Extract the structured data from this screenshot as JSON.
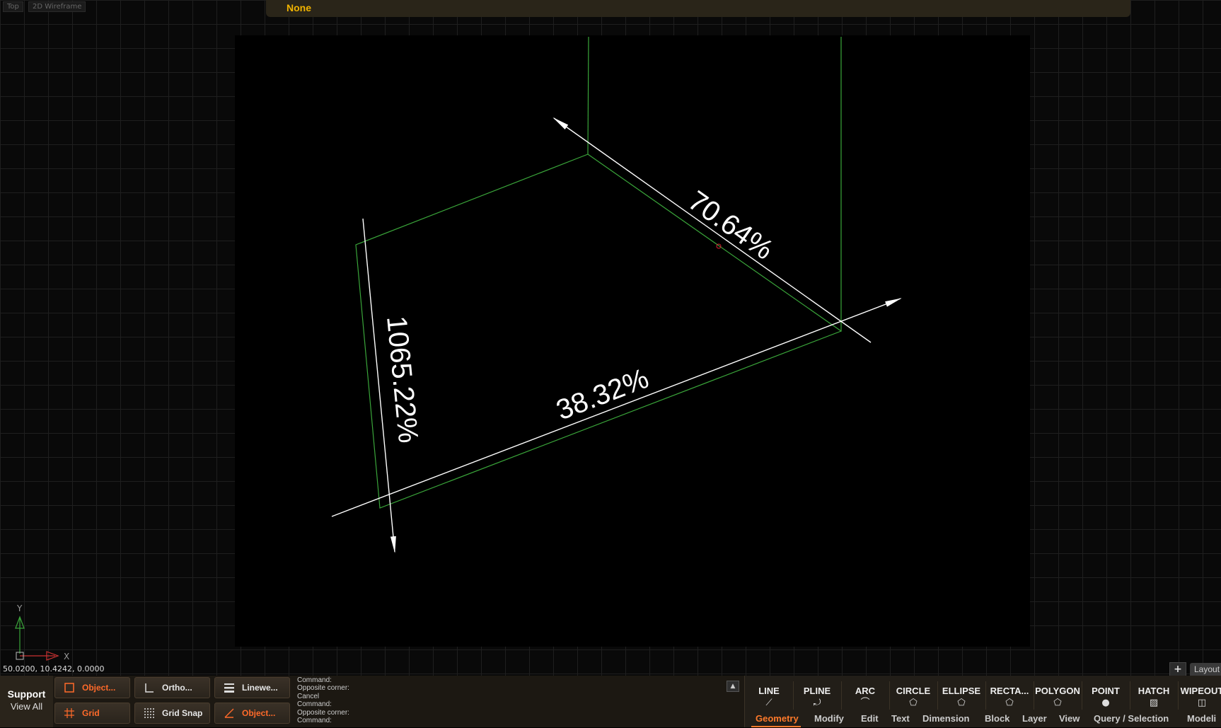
{
  "viewport": {
    "view_label": "Top",
    "visual_style_label": "2D Wireframe",
    "axis_y_label": "Y",
    "axis_x_label": "X"
  },
  "top_bar": {
    "current_value": "None"
  },
  "dimensions": [
    {
      "text": "70.64%"
    },
    {
      "text": "1065.22%"
    },
    {
      "text": "38.32%"
    }
  ],
  "coordinates": "50.0200, 10.4242, 0.0000",
  "layout": {
    "add_label": "+",
    "tab_label": "Layout"
  },
  "support": {
    "title": "Support",
    "view_all": "View All"
  },
  "toggles": [
    {
      "label": "Object...",
      "state": "on",
      "icon": "object-snap-icon"
    },
    {
      "label": "Ortho...",
      "state": "off",
      "icon": "ortho-icon"
    },
    {
      "label": "Linewe...",
      "state": "off",
      "icon": "lineweight-icon"
    },
    {
      "label": "Grid",
      "state": "on",
      "icon": "grid-icon"
    },
    {
      "label": "Grid Snap",
      "state": "off",
      "icon": "grid-snap-icon"
    },
    {
      "label": "Object...",
      "state": "on",
      "icon": "object-tracking-icon"
    }
  ],
  "command_history": [
    "Command:",
    "Opposite corner:",
    "Cancel",
    "Command:",
    "Opposite corner:",
    "Command:"
  ],
  "command_toggle": "▲",
  "ribbon": {
    "tools": [
      {
        "label": "LINE",
        "icon": "line-icon",
        "glyph": "⟋"
      },
      {
        "label": "PLINE",
        "icon": "polyline-icon",
        "glyph": "⤾"
      },
      {
        "label": "ARC",
        "icon": "arc-icon",
        "glyph": "⌒"
      },
      {
        "label": "CIRCLE",
        "icon": "circle-icon",
        "glyph": "⬠"
      },
      {
        "label": "ELLIPSE",
        "icon": "ellipse-icon",
        "glyph": "⬠"
      },
      {
        "label": "RECTA...",
        "icon": "rectangle-icon",
        "glyph": "⬠"
      },
      {
        "label": "POLYGON",
        "icon": "polygon-icon",
        "glyph": "⬠"
      },
      {
        "label": "POINT",
        "icon": "point-icon",
        "glyph": "●"
      },
      {
        "label": "HATCH",
        "icon": "hatch-icon",
        "glyph": "▨"
      },
      {
        "label": "WIPEOUT",
        "icon": "wipeout-icon",
        "glyph": "◫"
      }
    ],
    "tabs": [
      "Geometry",
      "Modify",
      "Edit",
      "Text",
      "Dimension",
      "Block",
      "Layer",
      "View",
      "Query / Selection",
      "Modeli"
    ],
    "active_tab": "Geometry"
  }
}
